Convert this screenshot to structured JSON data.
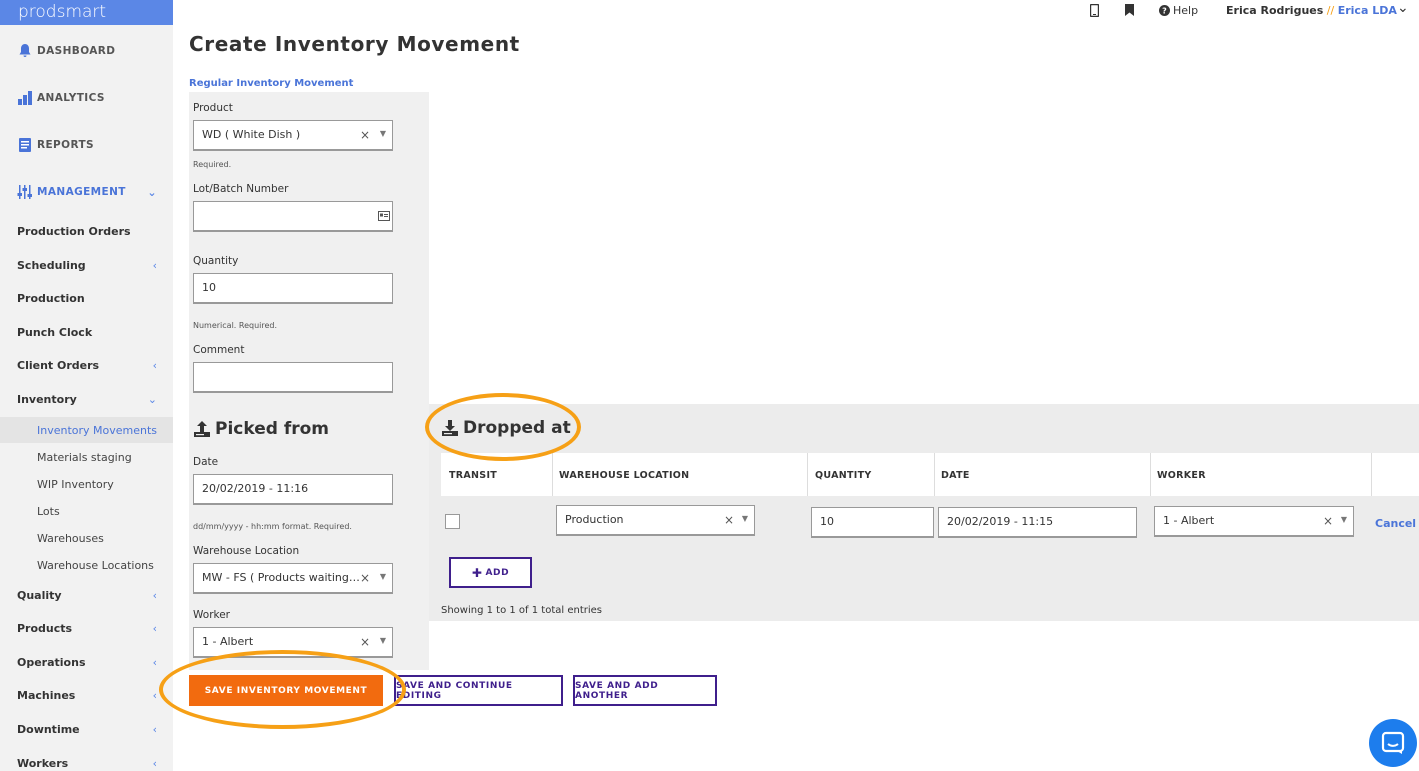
{
  "brand": "prodsmart",
  "topbar": {
    "help": "Help",
    "user": "Erica Rodrigues",
    "separator": "//",
    "company": "Erica LDA"
  },
  "sidebar": {
    "main": [
      {
        "label": "DASHBOARD",
        "icon": "bell-icon"
      },
      {
        "label": "ANALYTICS",
        "icon": "bar-chart-icon"
      },
      {
        "label": "REPORTS",
        "icon": "document-icon"
      },
      {
        "label": "MANAGEMENT",
        "icon": "sliders-icon"
      }
    ],
    "items": [
      {
        "label": "Production Orders",
        "chevron": ""
      },
      {
        "label": "Scheduling",
        "chevron": "‹"
      },
      {
        "label": "Production",
        "chevron": ""
      },
      {
        "label": "Punch Clock",
        "chevron": ""
      },
      {
        "label": "Client Orders",
        "chevron": "‹"
      },
      {
        "label": "Inventory",
        "chevron": "⌄"
      }
    ],
    "inventory_sub": [
      "Inventory Movements",
      "Materials staging",
      "WIP Inventory",
      "Lots",
      "Warehouses",
      "Warehouse Locations"
    ],
    "items_after": [
      {
        "label": "Quality",
        "chevron": "‹"
      },
      {
        "label": "Products",
        "chevron": "‹"
      },
      {
        "label": "Operations",
        "chevron": "‹"
      },
      {
        "label": "Machines",
        "chevron": "‹"
      },
      {
        "label": "Downtime",
        "chevron": "‹"
      },
      {
        "label": "Workers",
        "chevron": "‹"
      }
    ]
  },
  "page_title": "Create Inventory Movement",
  "form": {
    "type_label": "Regular Inventory Movement",
    "product_label": "Product",
    "product_value": "WD ( White Dish )",
    "product_help": "Required.",
    "lot_label": "Lot/Batch Number",
    "lot_value": "",
    "quantity_label": "Quantity",
    "quantity_value": "10",
    "quantity_help": "Numerical. Required.",
    "comment_label": "Comment",
    "comment_value": ""
  },
  "picked_from": {
    "heading": "Picked from",
    "date_label": "Date",
    "date_value": "20/02/2019 - 11:16",
    "date_help": "dd/mm/yyyy - hh:mm format. Required.",
    "location_label": "Warehouse Location",
    "location_value": "MW - FS ( Products waiting for shipping )",
    "worker_label": "Worker",
    "worker_value": "1 - Albert"
  },
  "dropped_at": {
    "heading": "Dropped at",
    "columns": [
      "TRANSIT",
      "WAREHOUSE LOCATION",
      "QUANTITY",
      "DATE",
      "WORKER"
    ],
    "row": {
      "transit": false,
      "location": "Production",
      "quantity": "10",
      "date": "20/02/2019 - 11:15",
      "worker": "1 - Albert",
      "cancel": "Cancel"
    },
    "add_label": "ADD",
    "showing": "Showing 1 to 1 of 1 total entries"
  },
  "buttons": {
    "save": "SAVE INVENTORY MOVEMENT",
    "save_continue": "SAVE AND CONTINUE EDITING",
    "save_another": "SAVE AND ADD ANOTHER"
  },
  "colors": {
    "brand": "#5b87e6",
    "accent_orange": "#f26b0f",
    "outline_purple": "#3f1f8c",
    "annotation": "#f6a016"
  }
}
